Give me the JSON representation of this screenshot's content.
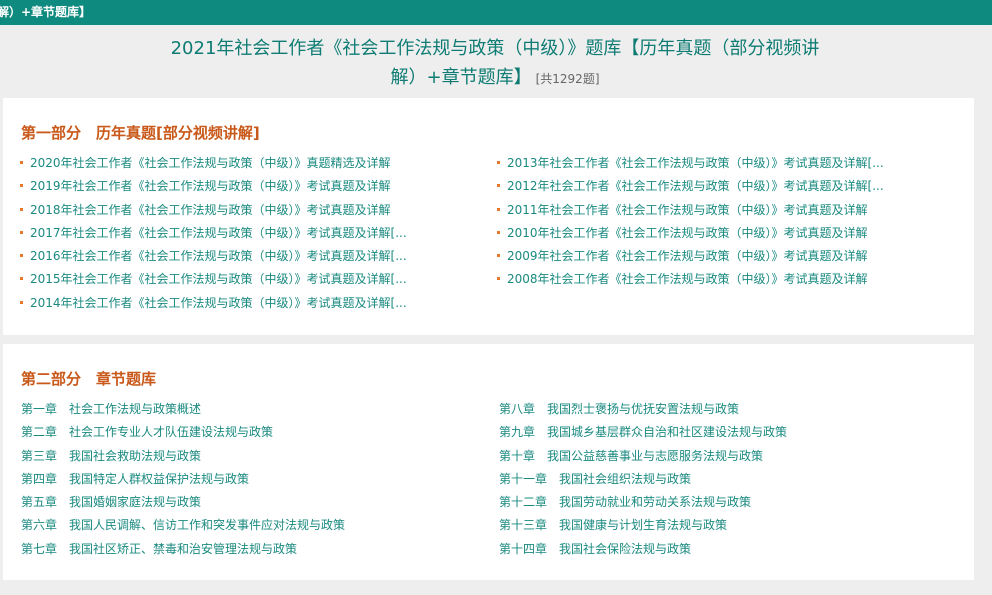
{
  "topbar": {
    "text": "解）+章节题库】"
  },
  "header": {
    "title_line1": "2021年社会工作者《社会工作法规与政策（中级）》题库【历年真题（部分视频讲",
    "title_line2": "解）+章节题库】",
    "count": "[共1292题]"
  },
  "section1": {
    "title": "第一部分　历年真题[部分视频讲解]",
    "left_items": [
      "2020年社会工作者《社会工作法规与政策（中级）》真题精选及详解",
      "2019年社会工作者《社会工作法规与政策（中级）》考试真题及详解",
      "2018年社会工作者《社会工作法规与政策（中级）》考试真题及详解",
      "2017年社会工作者《社会工作法规与政策（中级）》考试真题及详解[...",
      "2016年社会工作者《社会工作法规与政策（中级）》考试真题及详解[...",
      "2015年社会工作者《社会工作法规与政策（中级）》考试真题及详解[...",
      "2014年社会工作者《社会工作法规与政策（中级）》考试真题及详解[..."
    ],
    "right_items": [
      "2013年社会工作者《社会工作法规与政策（中级）》考试真题及详解[...",
      "2012年社会工作者《社会工作法规与政策（中级）》考试真题及详解[...",
      "2011年社会工作者《社会工作法规与政策（中级）》考试真题及详解",
      "2010年社会工作者《社会工作法规与政策（中级）》考试真题及详解",
      "2009年社会工作者《社会工作法规与政策（中级）》考试真题及详解",
      "2008年社会工作者《社会工作法规与政策（中级）》考试真题及详解"
    ]
  },
  "section2": {
    "title": "第二部分　章节题库",
    "left_items": [
      {
        "no": "第一章",
        "name": "社会工作法规与政策概述"
      },
      {
        "no": "第二章",
        "name": "社会工作专业人才队伍建设法规与政策"
      },
      {
        "no": "第三章",
        "name": "我国社会救助法规与政策"
      },
      {
        "no": "第四章",
        "name": "我国特定人群权益保护法规与政策"
      },
      {
        "no": "第五章",
        "name": "我国婚姻家庭法规与政策"
      },
      {
        "no": "第六章",
        "name": "我国人民调解、信访工作和突发事件应对法规与政策"
      },
      {
        "no": "第七章",
        "name": "我国社区矫正、禁毒和治安管理法规与政策"
      }
    ],
    "right_items": [
      {
        "no": "第八章",
        "name": "我国烈士褒扬与优抚安置法规与政策"
      },
      {
        "no": "第九章",
        "name": "我国城乡基层群众自治和社区建设法规与政策"
      },
      {
        "no": "第十章",
        "name": "我国公益慈善事业与志愿服务法规与政策"
      },
      {
        "no": "第十一章",
        "name": "我国社会组织法规与政策"
      },
      {
        "no": "第十二章",
        "name": "我国劳动就业和劳动关系法规与政策"
      },
      {
        "no": "第十三章",
        "name": "我国健康与计划生育法规与政策"
      },
      {
        "no": "第十四章",
        "name": "我国社会保险法规与政策"
      }
    ]
  }
}
